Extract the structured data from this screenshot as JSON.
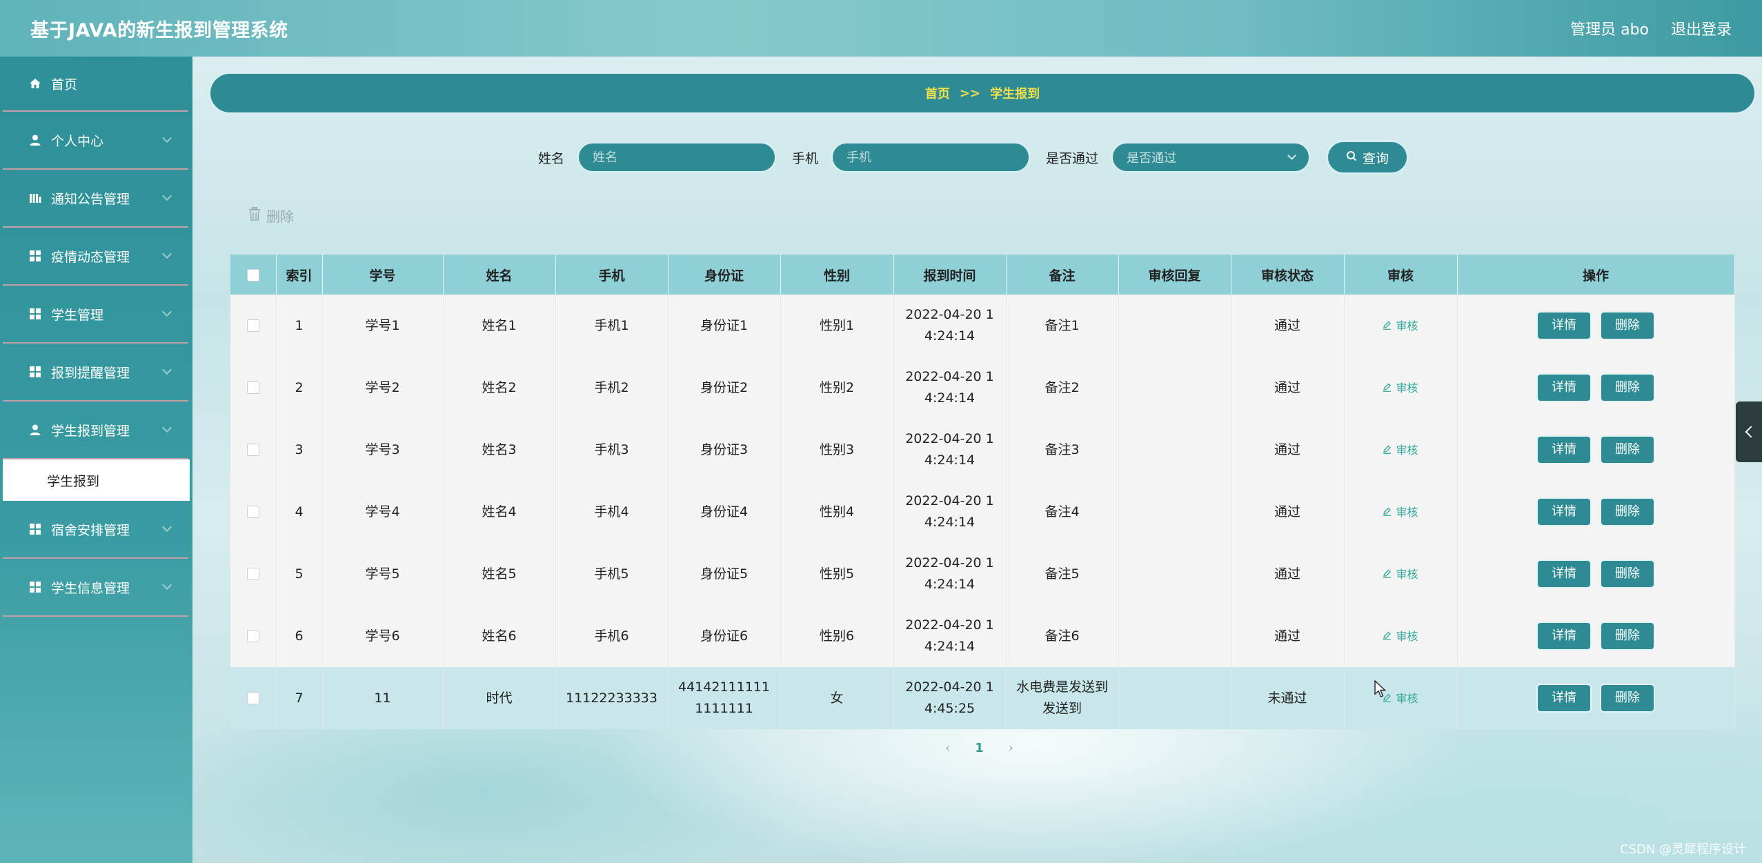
{
  "header": {
    "title": "基于JAVA的新生报到管理系统",
    "user": "管理员 abo",
    "logout": "退出登录"
  },
  "sidebar": {
    "items": [
      {
        "label": "首页",
        "icon": "home-icon"
      },
      {
        "label": "个人中心",
        "icon": "user-icon"
      },
      {
        "label": "通知公告管理",
        "icon": "chart-icon"
      },
      {
        "label": "疫情动态管理",
        "icon": "grid-icon"
      },
      {
        "label": "学生管理",
        "icon": "grid-icon"
      },
      {
        "label": "报到提醒管理",
        "icon": "grid-icon"
      },
      {
        "label": "学生报到管理",
        "icon": "user-icon"
      },
      {
        "label": "宿舍安排管理",
        "icon": "grid-icon"
      },
      {
        "label": "学生信息管理",
        "icon": "grid-icon"
      }
    ],
    "sub_item": "学生报到"
  },
  "breadcrumb": {
    "home": "首页",
    "sep": ">>",
    "current": "学生报到"
  },
  "search": {
    "name_label": "姓名",
    "name_placeholder": "姓名",
    "phone_label": "手机",
    "phone_placeholder": "手机",
    "passed_label": "是否通过",
    "passed_placeholder": "是否通过",
    "query_button": "查询"
  },
  "bulk_delete": "删除",
  "table": {
    "headers": [
      "索引",
      "学号",
      "姓名",
      "手机",
      "身份证",
      "性别",
      "报到时间",
      "备注",
      "审核回复",
      "审核状态",
      "审核",
      "操作"
    ],
    "rows": [
      {
        "index": "1",
        "student_id": "学号1",
        "name": "姓名1",
        "phone": "手机1",
        "id_card": "身份证1",
        "gender": "性别1",
        "time_a": "2022-04-20 1",
        "time_b": "4:24:14",
        "remark_a": "备注1",
        "remark_b": "",
        "reply": "",
        "status": "通过"
      },
      {
        "index": "2",
        "student_id": "学号2",
        "name": "姓名2",
        "phone": "手机2",
        "id_card": "身份证2",
        "gender": "性别2",
        "time_a": "2022-04-20 1",
        "time_b": "4:24:14",
        "remark_a": "备注2",
        "remark_b": "",
        "reply": "",
        "status": "通过"
      },
      {
        "index": "3",
        "student_id": "学号3",
        "name": "姓名3",
        "phone": "手机3",
        "id_card": "身份证3",
        "gender": "性别3",
        "time_a": "2022-04-20 1",
        "time_b": "4:24:14",
        "remark_a": "备注3",
        "remark_b": "",
        "reply": "",
        "status": "通过"
      },
      {
        "index": "4",
        "student_id": "学号4",
        "name": "姓名4",
        "phone": "手机4",
        "id_card": "身份证4",
        "gender": "性别4",
        "time_a": "2022-04-20 1",
        "time_b": "4:24:14",
        "remark_a": "备注4",
        "remark_b": "",
        "reply": "",
        "status": "通过"
      },
      {
        "index": "5",
        "student_id": "学号5",
        "name": "姓名5",
        "phone": "手机5",
        "id_card": "身份证5",
        "gender": "性别5",
        "time_a": "2022-04-20 1",
        "time_b": "4:24:14",
        "remark_a": "备注5",
        "remark_b": "",
        "reply": "",
        "status": "通过"
      },
      {
        "index": "6",
        "student_id": "学号6",
        "name": "姓名6",
        "phone": "手机6",
        "id_card": "身份证6",
        "gender": "性别6",
        "time_a": "2022-04-20 1",
        "time_b": "4:24:14",
        "remark_a": "备注6",
        "remark_b": "",
        "reply": "",
        "status": "通过"
      },
      {
        "index": "7",
        "student_id": "11",
        "name": "时代",
        "phone": "11122233333",
        "id_card": "441421111111111111",
        "gender": "女",
        "time_a": "2022-04-20 1",
        "time_b": "4:45:25",
        "remark_a": "水电费是发送到",
        "remark_b": "发送到",
        "reply": "",
        "status": "未通过"
      }
    ],
    "audit_link": "审核",
    "detail_button": "详情",
    "delete_button": "删除"
  },
  "pagination": {
    "prev": "‹",
    "current": "1",
    "next": "›"
  },
  "watermark": "CSDN @灵犀程序设计",
  "colors": {
    "primary": "#2e8b93",
    "header_row": "#8fd0d6",
    "breadcrumb_text": "#f2e14a"
  }
}
